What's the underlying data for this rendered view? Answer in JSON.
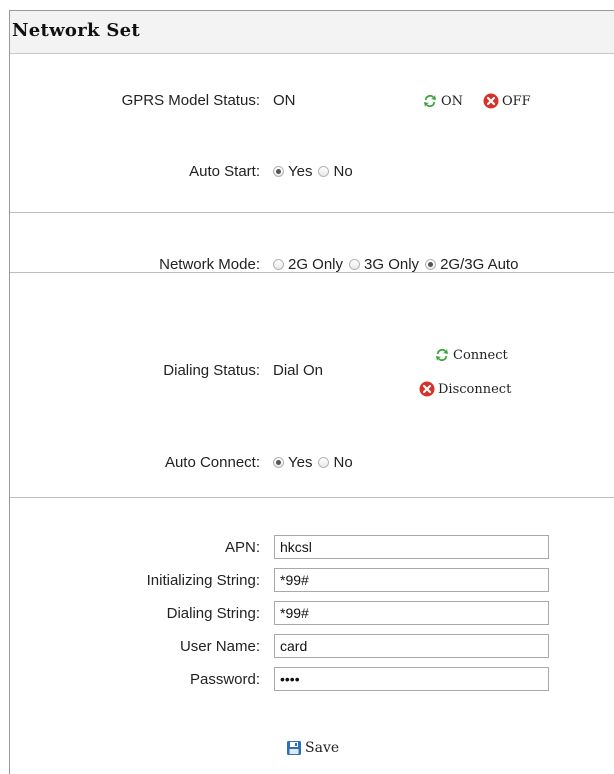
{
  "header": {
    "title": "Network Set"
  },
  "gprs": {
    "status_label": "GPRS Model Status:",
    "status_value": "ON",
    "on_label": "ON",
    "off_label": "OFF",
    "auto_start_label": "Auto Start:",
    "auto_start_options": [
      "Yes",
      "No"
    ],
    "auto_start_selected": "Yes"
  },
  "network": {
    "mode_label": "Network Mode:",
    "mode_options": [
      "2G Only",
      "3G Only",
      "2G/3G Auto"
    ],
    "mode_selected": "2G/3G Auto"
  },
  "dialing": {
    "status_label": "Dialing Status:",
    "status_value": "Dial On",
    "connect_label": "Connect",
    "disconnect_label": "Disconnect",
    "auto_connect_label": "Auto Connect:",
    "auto_connect_options": [
      "Yes",
      "No"
    ],
    "auto_connect_selected": "Yes"
  },
  "form": {
    "apn_label": "APN:",
    "apn_value": "hkcsl",
    "init_label": "Initializing String:",
    "init_value": "*99#",
    "dial_label": "Dialing String:",
    "dial_value": "*99#",
    "user_label": "User Name:",
    "user_value": "card",
    "password_label": "Password:",
    "password_value": "card",
    "save_label": "Save"
  },
  "colors": {
    "accent_green": "#3aa33a",
    "accent_red": "#d9302c",
    "save_blue": "#2f6fb5"
  }
}
